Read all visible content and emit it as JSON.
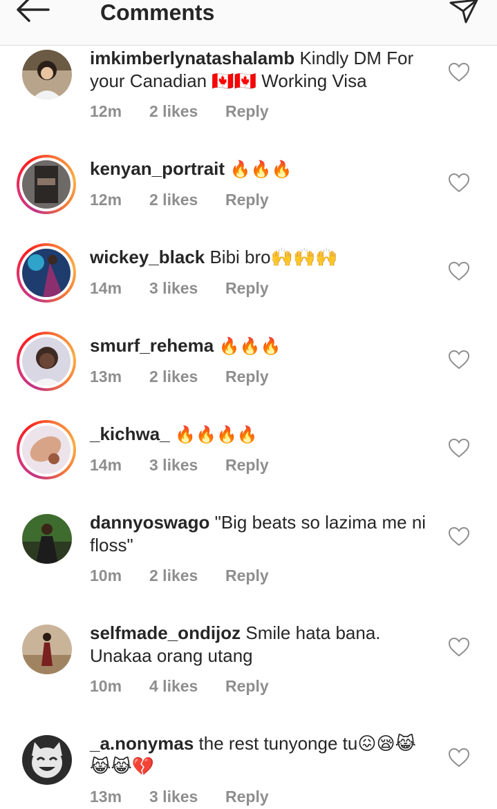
{
  "header": {
    "title": "Comments",
    "back_icon": "arrow-left-icon",
    "send_icon": "paper-plane-icon"
  },
  "comments": [
    {
      "username": "imkimberlynatashalamb",
      "text": " Kindly DM For your Canadian 🇨🇦🇨🇦 Working Visa",
      "time": "12m",
      "likes": "2 likes",
      "reply": "Reply",
      "story_ring": false
    },
    {
      "username": "kenyan_portrait",
      "text": " 🔥🔥🔥",
      "time": "12m",
      "likes": "2 likes",
      "reply": "Reply",
      "story_ring": true
    },
    {
      "username": "wickey_black",
      "text": " Bibi bro🙌🙌🙌",
      "time": "14m",
      "likes": "3 likes",
      "reply": "Reply",
      "story_ring": true
    },
    {
      "username": "smurf_rehema",
      "text": " 🔥🔥🔥",
      "time": "13m",
      "likes": "2 likes",
      "reply": "Reply",
      "story_ring": true
    },
    {
      "username": "_kichwa_",
      "text": " 🔥🔥🔥🔥",
      "time": "14m",
      "likes": "3 likes",
      "reply": "Reply",
      "story_ring": true
    },
    {
      "username": "dannyoswago",
      "text": " \"Big beats so lazima me ni floss\"",
      "time": "10m",
      "likes": "2 likes",
      "reply": "Reply",
      "story_ring": false
    },
    {
      "username": "selfmade_ondijoz",
      "text": " Smile hata bana. Unakaa orang utang",
      "time": "10m",
      "likes": "4 likes",
      "reply": "Reply",
      "story_ring": false
    },
    {
      "username": "_a.nonymas",
      "text": " the rest tunyonge tu😖😪😹😹😹💔",
      "time": "13m",
      "likes": "3 likes",
      "reply": "Reply",
      "story_ring": false
    }
  ],
  "icons": {
    "like": "heart-outline-icon"
  },
  "colors": {
    "meta_gray": "#8e8e8e",
    "header_bg": "#fafafa",
    "ring_start": "#c13584",
    "ring_end": "#fcaf45"
  }
}
